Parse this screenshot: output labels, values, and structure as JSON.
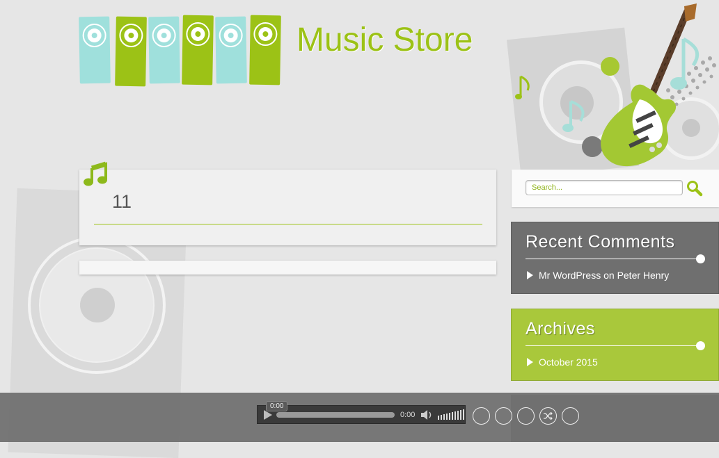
{
  "site": {
    "title": "Music Store"
  },
  "colors": {
    "brand_green": "#9cc216",
    "teal": "#9fe0dc",
    "recent_comments_bg": "#6f6f6f",
    "archives_bg": "#a9c83b"
  },
  "post": {
    "title": "11",
    "icon": "music-note-icon"
  },
  "search": {
    "placeholder": "Search..."
  },
  "sidebar": {
    "recent_comments": {
      "title": "Recent Comments",
      "items": [
        {
          "author": "Mr WordPress",
          "on": "on",
          "post": "Peter Henry"
        }
      ]
    },
    "archives": {
      "title": "Archives",
      "items": [
        {
          "label": "October 2015"
        }
      ]
    }
  },
  "player": {
    "time_tooltip": "0:00",
    "current_time": "0:00",
    "progress": 0,
    "controls": [
      "previous-button",
      "play-pause-button",
      "next-button",
      "shuffle-button",
      "playlist-button"
    ]
  }
}
